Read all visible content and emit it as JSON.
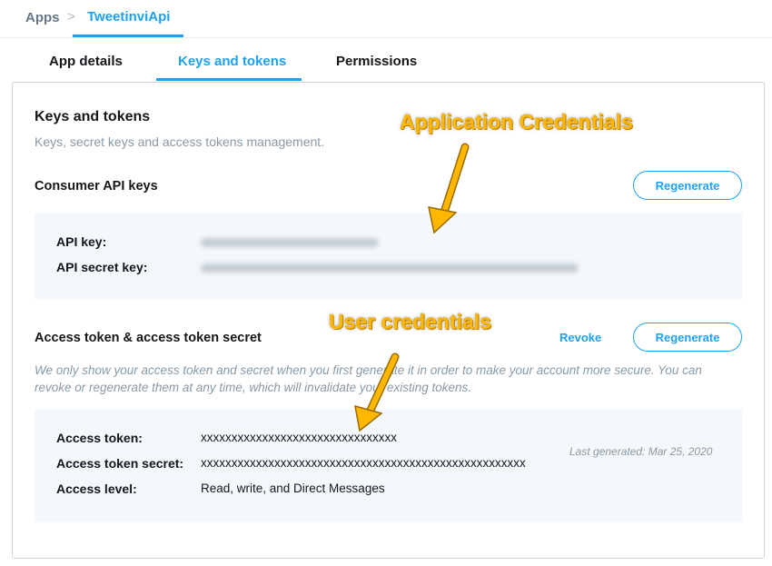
{
  "breadcrumb": {
    "root": "Apps",
    "separator": ">",
    "current": "TweetinviApi"
  },
  "tabs": [
    {
      "label": "App details",
      "active": false
    },
    {
      "label": "Keys and tokens",
      "active": true
    },
    {
      "label": "Permissions",
      "active": false
    }
  ],
  "page": {
    "title": "Keys and tokens",
    "subtitle": "Keys, secret keys and access tokens management."
  },
  "consumer": {
    "title": "Consumer API keys",
    "regenerate_label": "Regenerate",
    "rows": [
      {
        "label": "API key:",
        "value_hidden": true
      },
      {
        "label": "API secret key:",
        "value_hidden": true
      }
    ]
  },
  "access": {
    "title": "Access token & access token secret",
    "revoke_label": "Revoke",
    "regenerate_label": "Regenerate",
    "note": "We only show your access token and secret when you first generate it in order to make your account more secure. You can revoke or regenerate them at any time, which will invalidate your existing tokens.",
    "rows": [
      {
        "label": "Access token:",
        "value": "xxxxxxxxxxxxxxxxxxxxxxxxxxxxxxxx"
      },
      {
        "label": "Access token secret:",
        "value": "xxxxxxxxxxxxxxxxxxxxxxxxxxxxxxxxxxxxxxxxxxxxxxxxxxxxx"
      },
      {
        "label": "Access level:",
        "value": "Read, write, and Direct Messages"
      }
    ],
    "last_generated": "Last generated: Mar 25, 2020"
  },
  "annotations": {
    "application": "Application Credentials",
    "user": "User credentials"
  },
  "colors": {
    "accent": "#1da1f2",
    "annotation": "#ffb700",
    "panel_bg": "#f5f8fa"
  }
}
